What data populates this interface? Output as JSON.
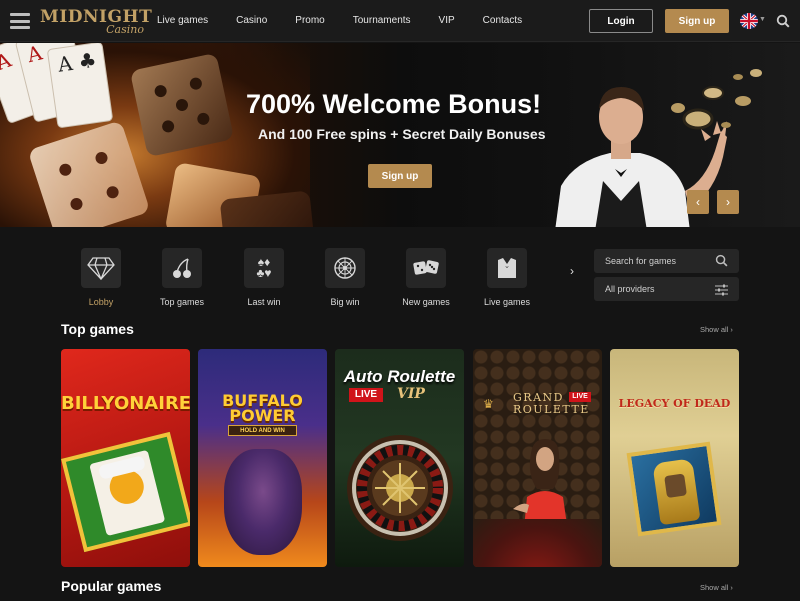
{
  "header": {
    "logo_line1": "MIDNIGHT",
    "logo_line2": "Casino",
    "nav": [
      "Live games",
      "Casino",
      "Promo",
      "Tournaments",
      "VIP",
      "Contacts"
    ],
    "login_label": "Login",
    "signup_label": "Sign up",
    "language": "en-flag-icon"
  },
  "hero": {
    "title": "700% Welcome Bonus!",
    "subtitle": "And 100 Free spins + Secret Daily Bonuses",
    "cta_label": "Sign up",
    "prev_label": "‹",
    "next_label": "›"
  },
  "categories": [
    {
      "label": "Lobby",
      "icon": "diamond-icon",
      "active": true
    },
    {
      "label": "Top games",
      "icon": "cherries-icon",
      "active": false
    },
    {
      "label": "Last win",
      "icon": "card-suits-icon",
      "active": false
    },
    {
      "label": "Big win",
      "icon": "roulette-icon",
      "active": false
    },
    {
      "label": "New games",
      "icon": "dice-icon",
      "active": false
    },
    {
      "label": "Live games",
      "icon": "dealer-icon",
      "active": false
    }
  ],
  "search": {
    "placeholder": "Search for games"
  },
  "providers": {
    "label": "All providers"
  },
  "top_games": {
    "title": "Top games",
    "show_all": "Show all ›",
    "games": [
      {
        "name": "BILLYONAIRE"
      },
      {
        "name": "BUFFALO POWER",
        "tagline": "HOLD AND WIN"
      },
      {
        "name": "Auto Roulette",
        "badge": "LIVE",
        "suffix": "VIP"
      },
      {
        "name": "GRAND ROULETTE",
        "badge": "LIVE"
      },
      {
        "name": "LEGACY OF DEAD"
      }
    ]
  },
  "popular_games": {
    "title": "Popular games",
    "show_all": "Show all ›"
  },
  "colors": {
    "accent": "#b48a4f",
    "gold_text": "#c2a166",
    "background": "#141414",
    "header": "#1b1b1b"
  }
}
